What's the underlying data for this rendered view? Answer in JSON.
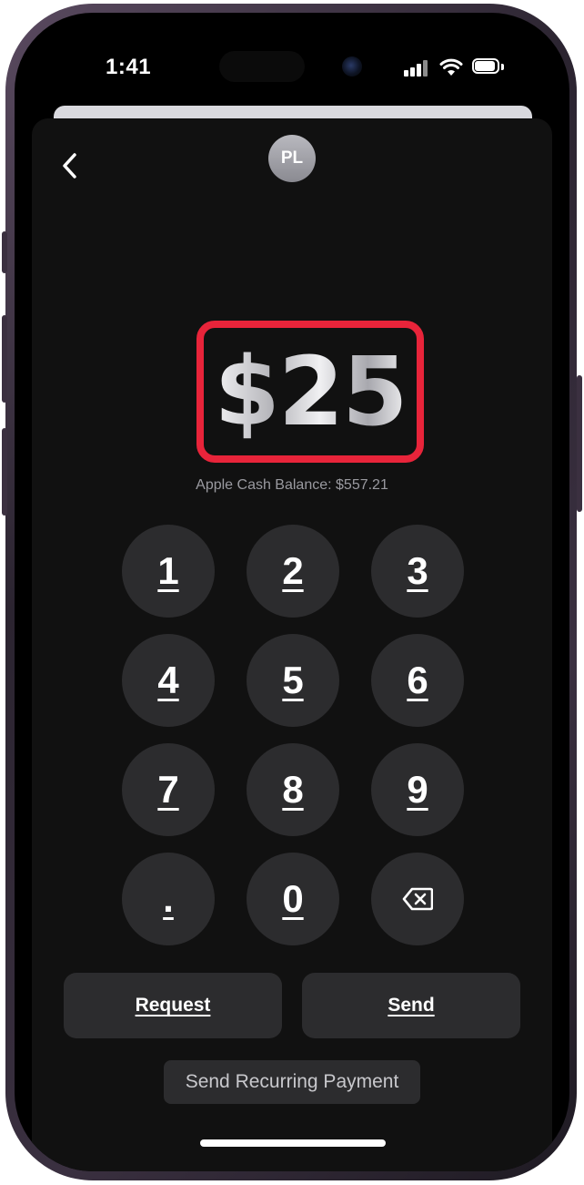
{
  "status_bar": {
    "time": "1:41",
    "icons": [
      "cellular-signal-icon",
      "wifi-icon",
      "battery-icon"
    ]
  },
  "header": {
    "back_icon": "chevron-left-icon",
    "avatar_initials": "PL"
  },
  "payment": {
    "amount": "$25",
    "balance_label": "Apple Cash Balance: $557.21"
  },
  "keypad": {
    "keys": [
      "1",
      "2",
      "3",
      "4",
      "5",
      "6",
      "7",
      "8",
      "9",
      ".",
      "0"
    ],
    "delete_icon": "backspace-icon"
  },
  "actions": {
    "request_label": "Request",
    "send_label": "Send",
    "recurring_label": "Send Recurring Payment"
  },
  "colors": {
    "highlight_box": "#e8243a",
    "background": "#111111",
    "key_background": "#2c2c2e"
  }
}
